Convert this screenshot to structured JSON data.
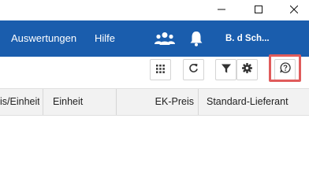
{
  "menu": {
    "items": [
      {
        "label": "Auswertungen"
      },
      {
        "label": "Hilfe"
      }
    ],
    "user_name": "B. d Sch..."
  },
  "icons": {
    "minimize": "minimize-icon",
    "maximize": "maximize-icon",
    "close": "close-icon",
    "users": "users-icon",
    "bell": "bell-icon",
    "grid": "grid-icon",
    "refresh": "refresh-icon",
    "filter": "filter-icon",
    "settings": "gear-icon",
    "help": "help-chat-icon"
  },
  "table": {
    "columns": [
      {
        "label": "is/Einheit"
      },
      {
        "label": "Einheit"
      },
      {
        "label": "EK-Preis"
      },
      {
        "label": "Standard-Lieferant"
      }
    ]
  },
  "colors": {
    "menubar": "#1a5dad",
    "header": "#f2f2f2",
    "highlight": "#e05c5c"
  }
}
